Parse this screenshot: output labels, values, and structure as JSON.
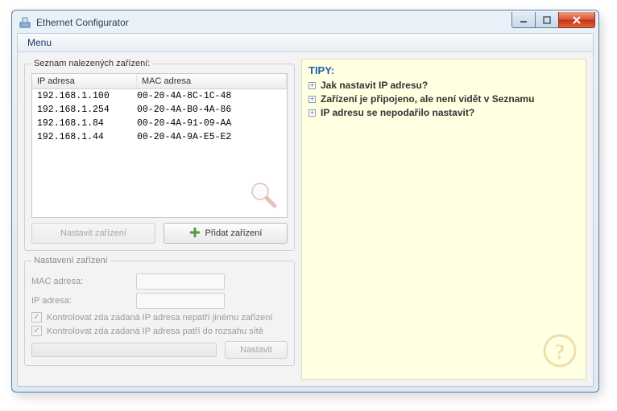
{
  "window": {
    "title": "Ethernet Configurator"
  },
  "menu": {
    "label": "Menu"
  },
  "device_list": {
    "legend": "Seznam nalezených zařízení:",
    "columns": {
      "ip": "IP adresa",
      "mac": "MAC adresa"
    },
    "rows": [
      {
        "ip": "192.168.1.100",
        "mac": "00-20-4A-8C-1C-48"
      },
      {
        "ip": "192.168.1.254",
        "mac": "00-20-4A-B0-4A-86"
      },
      {
        "ip": "192.168.1.84",
        "mac": "00-20-4A-91-09-AA"
      },
      {
        "ip": "192.168.1.44",
        "mac": "00-20-4A-9A-E5-E2"
      }
    ]
  },
  "buttons": {
    "configure": "Nastavit zařízení",
    "add": "Přidat zařízení",
    "apply": "Nastavit"
  },
  "settings": {
    "legend": "Nastavení zařízení",
    "mac_label": "MAC adresa:",
    "ip_label": "IP adresa:",
    "chk1": "Kontrolovat zda zadaná IP adresa nepatří jinému zařízení",
    "chk2": "Kontrolovat zda zadaná IP adresa patří do rozsahu sítě"
  },
  "tips": {
    "title": "TIPY:",
    "items": [
      "Jak nastavit IP adresu?",
      "Zařízení je připojeno, ale není vidět v Seznamu",
      "IP adresu se nepodařilo nastavit?"
    ]
  }
}
